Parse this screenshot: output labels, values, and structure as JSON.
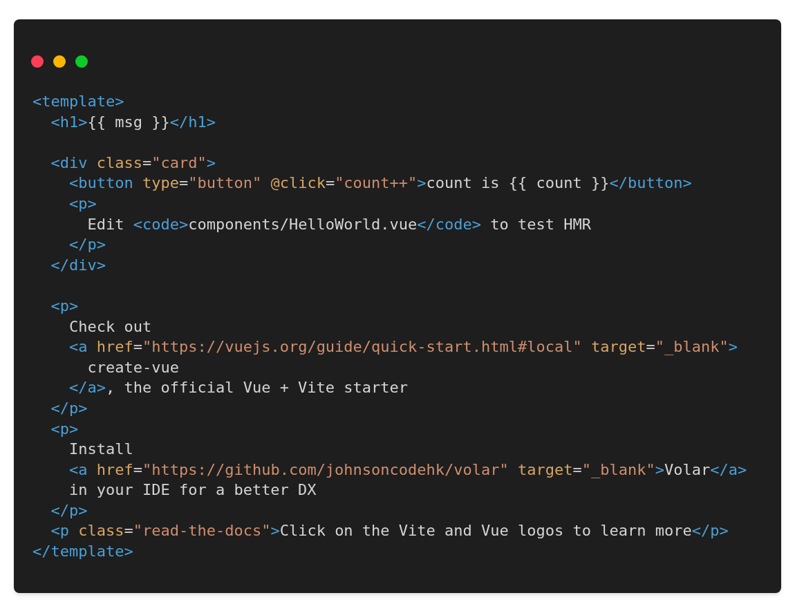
{
  "window": {
    "controls": [
      {
        "kind": "close"
      },
      {
        "kind": "minimize"
      },
      {
        "kind": "zoom"
      }
    ]
  },
  "code_lines": [
    {
      "kind": "code",
      "tokens": [
        {
          "kind": "tag",
          "text": "<template>"
        }
      ]
    },
    {
      "kind": "code",
      "tokens": [
        {
          "kind": "tag",
          "text": "  <h1>"
        },
        {
          "kind": "text",
          "text": "{{ msg }}"
        },
        {
          "kind": "tag",
          "text": "</h1>"
        }
      ]
    },
    {
      "kind": "blank"
    },
    {
      "kind": "code",
      "tokens": [
        {
          "kind": "tag",
          "text": "  <div"
        },
        {
          "kind": "attr",
          "text": " class"
        },
        {
          "kind": "text",
          "text": "="
        },
        {
          "kind": "string",
          "text": "\"card\""
        },
        {
          "kind": "tag",
          "text": ">"
        }
      ]
    },
    {
      "kind": "code",
      "tokens": [
        {
          "kind": "tag",
          "text": "    <button"
        },
        {
          "kind": "attr",
          "text": " type"
        },
        {
          "kind": "text",
          "text": "="
        },
        {
          "kind": "string",
          "text": "\"button\""
        },
        {
          "kind": "attr",
          "text": " @click"
        },
        {
          "kind": "text",
          "text": "="
        },
        {
          "kind": "string",
          "text": "\"count++\""
        },
        {
          "kind": "tag",
          "text": ">"
        },
        {
          "kind": "text",
          "text": "count is {{ count }}"
        },
        {
          "kind": "tag",
          "text": "</button>"
        }
      ]
    },
    {
      "kind": "code",
      "tokens": [
        {
          "kind": "tag",
          "text": "    <p>"
        }
      ]
    },
    {
      "kind": "code",
      "tokens": [
        {
          "kind": "text",
          "text": "      Edit "
        },
        {
          "kind": "tag",
          "text": "<code>"
        },
        {
          "kind": "text",
          "text": "components/HelloWorld.vue"
        },
        {
          "kind": "tag",
          "text": "</code>"
        },
        {
          "kind": "text",
          "text": " to test HMR"
        }
      ]
    },
    {
      "kind": "code",
      "tokens": [
        {
          "kind": "tag",
          "text": "    </p>"
        }
      ]
    },
    {
      "kind": "code",
      "tokens": [
        {
          "kind": "tag",
          "text": "  </div>"
        }
      ]
    },
    {
      "kind": "blank"
    },
    {
      "kind": "code",
      "tokens": [
        {
          "kind": "tag",
          "text": "  <p>"
        }
      ]
    },
    {
      "kind": "code",
      "tokens": [
        {
          "kind": "text",
          "text": "    Check out"
        }
      ]
    },
    {
      "kind": "code",
      "tokens": [
        {
          "kind": "tag",
          "text": "    <a"
        },
        {
          "kind": "attr",
          "text": " href"
        },
        {
          "kind": "text",
          "text": "="
        },
        {
          "kind": "string",
          "text": "\"https://vuejs.org/guide/quick-start.html#local\""
        },
        {
          "kind": "attr",
          "text": " target"
        },
        {
          "kind": "text",
          "text": "="
        },
        {
          "kind": "string",
          "text": "\"_blank\""
        },
        {
          "kind": "tag",
          "text": ">"
        }
      ]
    },
    {
      "kind": "code",
      "tokens": [
        {
          "kind": "text",
          "text": "      create-vue"
        }
      ]
    },
    {
      "kind": "code",
      "tokens": [
        {
          "kind": "tag",
          "text": "    </a>"
        },
        {
          "kind": "text",
          "text": ", the official Vue + Vite starter"
        }
      ]
    },
    {
      "kind": "code",
      "tokens": [
        {
          "kind": "tag",
          "text": "  </p>"
        }
      ]
    },
    {
      "kind": "code",
      "tokens": [
        {
          "kind": "tag",
          "text": "  <p>"
        }
      ]
    },
    {
      "kind": "code",
      "tokens": [
        {
          "kind": "text",
          "text": "    Install"
        }
      ]
    },
    {
      "kind": "code",
      "tokens": [
        {
          "kind": "tag",
          "text": "    <a"
        },
        {
          "kind": "attr",
          "text": " href"
        },
        {
          "kind": "text",
          "text": "="
        },
        {
          "kind": "string",
          "text": "\"https://github.com/johnsoncodehk/volar\""
        },
        {
          "kind": "attr",
          "text": " target"
        },
        {
          "kind": "text",
          "text": "="
        },
        {
          "kind": "string",
          "text": "\"_blank\""
        },
        {
          "kind": "tag",
          "text": ">"
        },
        {
          "kind": "text",
          "text": "Volar"
        },
        {
          "kind": "tag",
          "text": "</a>"
        }
      ]
    },
    {
      "kind": "code",
      "tokens": [
        {
          "kind": "text",
          "text": "    in your IDE for a better DX"
        }
      ]
    },
    {
      "kind": "code",
      "tokens": [
        {
          "kind": "tag",
          "text": "  </p>"
        }
      ]
    },
    {
      "kind": "code",
      "tokens": [
        {
          "kind": "tag",
          "text": "  <p"
        },
        {
          "kind": "attr",
          "text": " class"
        },
        {
          "kind": "text",
          "text": "="
        },
        {
          "kind": "string",
          "text": "\"read-the-docs\""
        },
        {
          "kind": "tag",
          "text": ">"
        },
        {
          "kind": "text",
          "text": "Click on the Vite and Vue logos to learn more"
        },
        {
          "kind": "tag",
          "text": "</p>"
        }
      ]
    },
    {
      "kind": "code",
      "tokens": [
        {
          "kind": "tag",
          "text": "</template>"
        }
      ]
    }
  ]
}
